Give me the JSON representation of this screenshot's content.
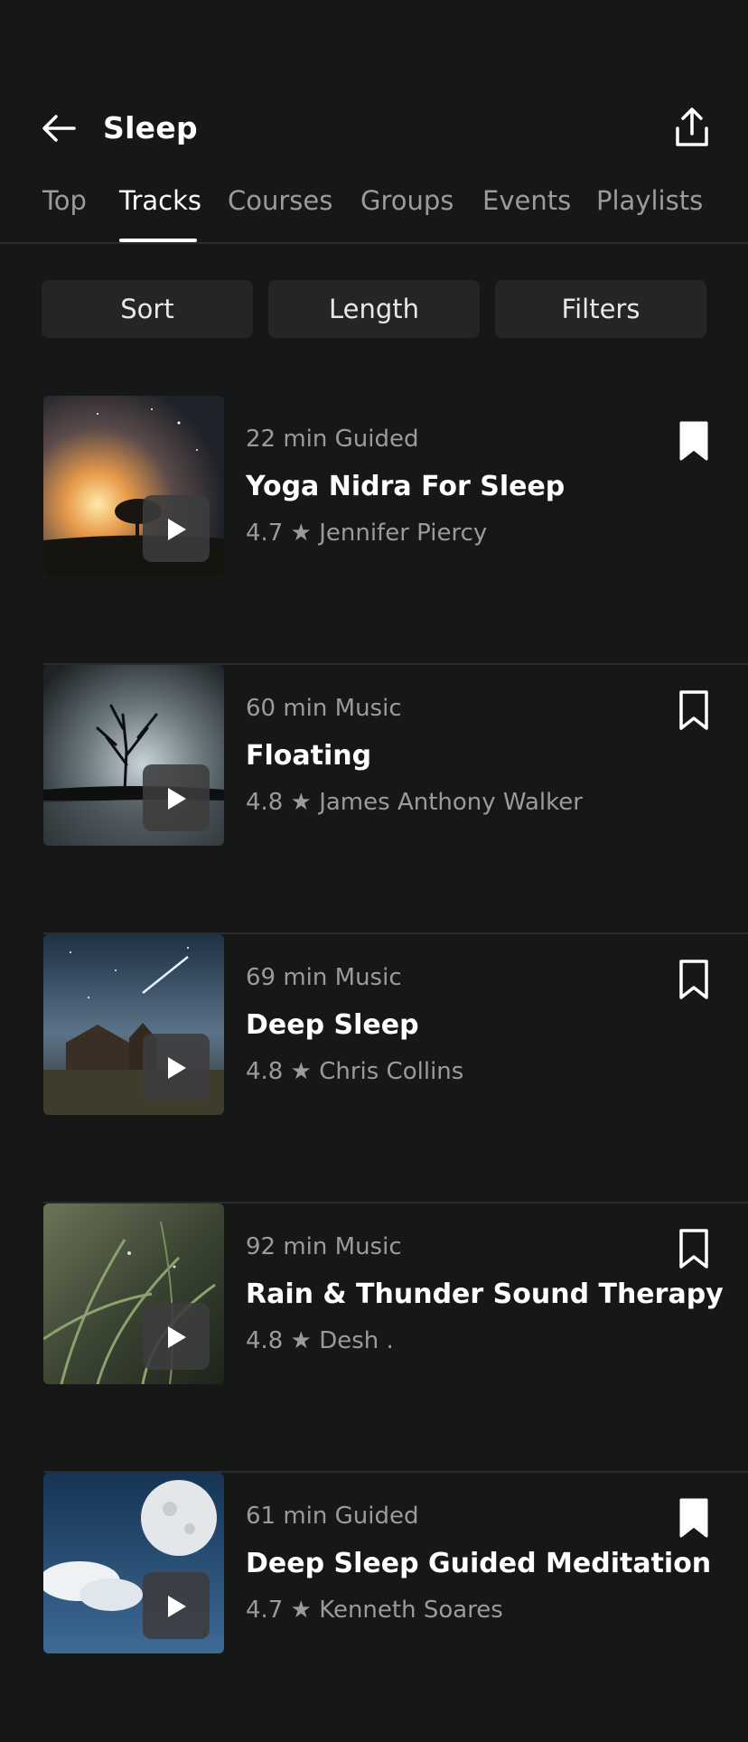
{
  "header": {
    "title": "Sleep",
    "back_icon": "arrow-left-icon",
    "share_icon": "share-icon"
  },
  "tabs": [
    {
      "label": "Top",
      "active": false
    },
    {
      "label": "Tracks",
      "active": true
    },
    {
      "label": "Courses",
      "active": false
    },
    {
      "label": "Groups",
      "active": false
    },
    {
      "label": "Events",
      "active": false
    },
    {
      "label": "Playlists",
      "active": false
    }
  ],
  "filters": {
    "sort_label": "Sort",
    "length_label": "Length",
    "filters_label": "Filters"
  },
  "tracks": [
    {
      "meta": "22 min Guided",
      "title": "Yoga Nidra For Sleep",
      "rating": "4.7",
      "author": "Jennifer Piercy",
      "bookmarked": true
    },
    {
      "meta": "60 min Music",
      "title": "Floating",
      "rating": "4.8",
      "author": "James Anthony Walker",
      "bookmarked": false
    },
    {
      "meta": "69 min Music",
      "title": "Deep Sleep",
      "rating": "4.8",
      "author": "Chris Collins",
      "bookmarked": false
    },
    {
      "meta": "92 min Music",
      "title": "Rain & Thunder Sound Therapy",
      "rating": "4.8",
      "author": "Desh .",
      "bookmarked": false
    },
    {
      "meta": "61 min Guided",
      "title": "Deep Sleep Guided Meditation",
      "rating": "4.7",
      "author": "Kenneth Soares",
      "bookmarked": true
    }
  ],
  "star_glyph": "★",
  "colors": {
    "background": "#161717",
    "chip": "#242526",
    "muted_text": "#9a9b9c",
    "divider": "#2a2b2c"
  }
}
